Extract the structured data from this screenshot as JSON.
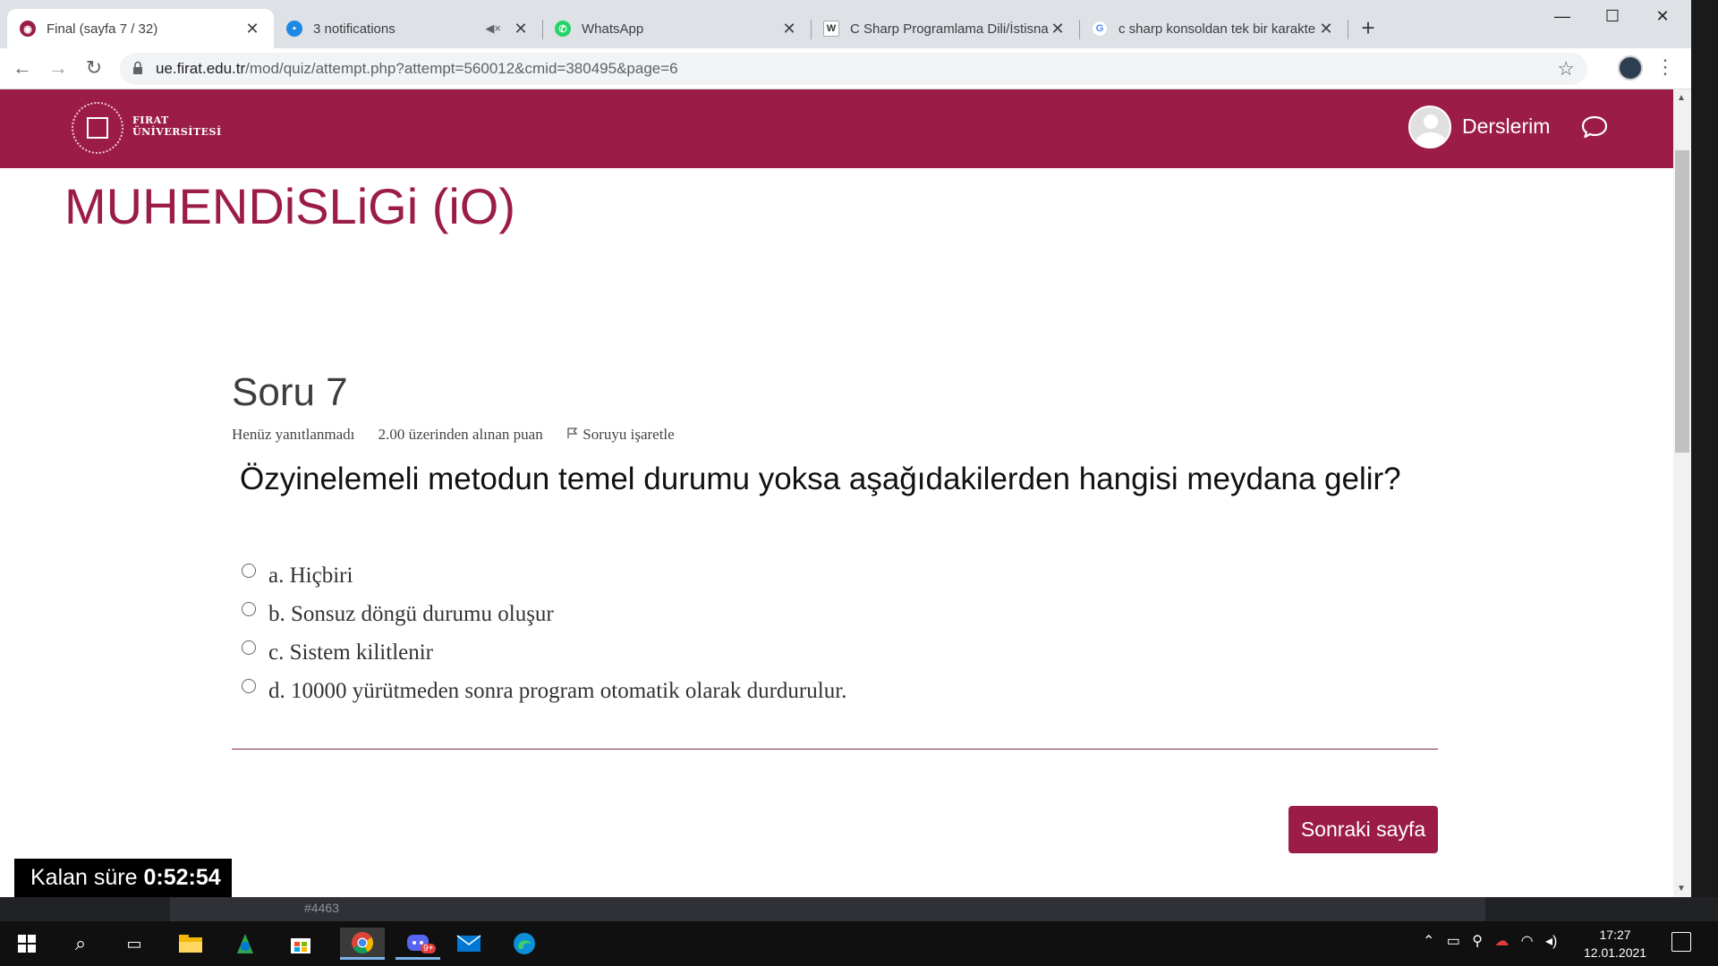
{
  "browser": {
    "tabs": [
      {
        "title": "Final (sayfa 7 / 32)",
        "close": "✕",
        "favicon": "firat-logo-icon",
        "active": true
      },
      {
        "title": "3 notifications",
        "close": "✕",
        "favicon": "chat-bubble-icon",
        "muted_icon": "speaker-mute-icon",
        "active": false
      },
      {
        "title": "WhatsApp",
        "close": "✕",
        "favicon": "whatsapp-icon",
        "active": false
      },
      {
        "title": "C Sharp Programlama Dili/İstisna",
        "close": "✕",
        "favicon": "wikibooks-icon",
        "active": false
      },
      {
        "title": "c sharp konsoldan tek bir karakte",
        "close": "✕",
        "favicon": "google-icon",
        "active": false
      }
    ],
    "new_tab": "+",
    "window_controls": {
      "minimize": "—",
      "maximize": "☐",
      "close": "✕"
    },
    "url_host": "ue.firat.edu.tr",
    "url_path": "/mod/quiz/attempt.php?attempt=560012&cmid=380495&page=6",
    "back": "←",
    "forward": "→",
    "reload": "↻",
    "star": "☆",
    "menu": "⋮"
  },
  "site": {
    "logo_text_line1": "FIRAT",
    "logo_text_line2": "ÜNİVERSİTESİ",
    "user_menu": "Derslerim",
    "brand_color": "#9b1d47"
  },
  "page": {
    "course_title": "MUHENDiSLiGi (iO)",
    "question_heading": "Soru 7",
    "status": "Henüz yanıtlanmadı",
    "points": "2.00 üzerinden alınan puan",
    "flag_label": "Soruyu işaretle",
    "question_text": "Özyinelemeli metodun temel durumu yoksa aşağıdakilerden hangisi meydana gelir?",
    "answers": [
      "a. Hiçbiri",
      "b. Sonsuz döngü durumu oluşur",
      "c. Sistem kilitlenir",
      "d. 10000 yürütmeden sonra program otomatik olarak durdurulur."
    ],
    "next_button": "Sonraki sayfa"
  },
  "timer": {
    "label": "Kalan süre",
    "value": "0:52:54"
  },
  "background_app": {
    "text": "#4463"
  },
  "taskbar": {
    "badge": "9+",
    "time": "17:27",
    "date": "12.01.2021"
  }
}
